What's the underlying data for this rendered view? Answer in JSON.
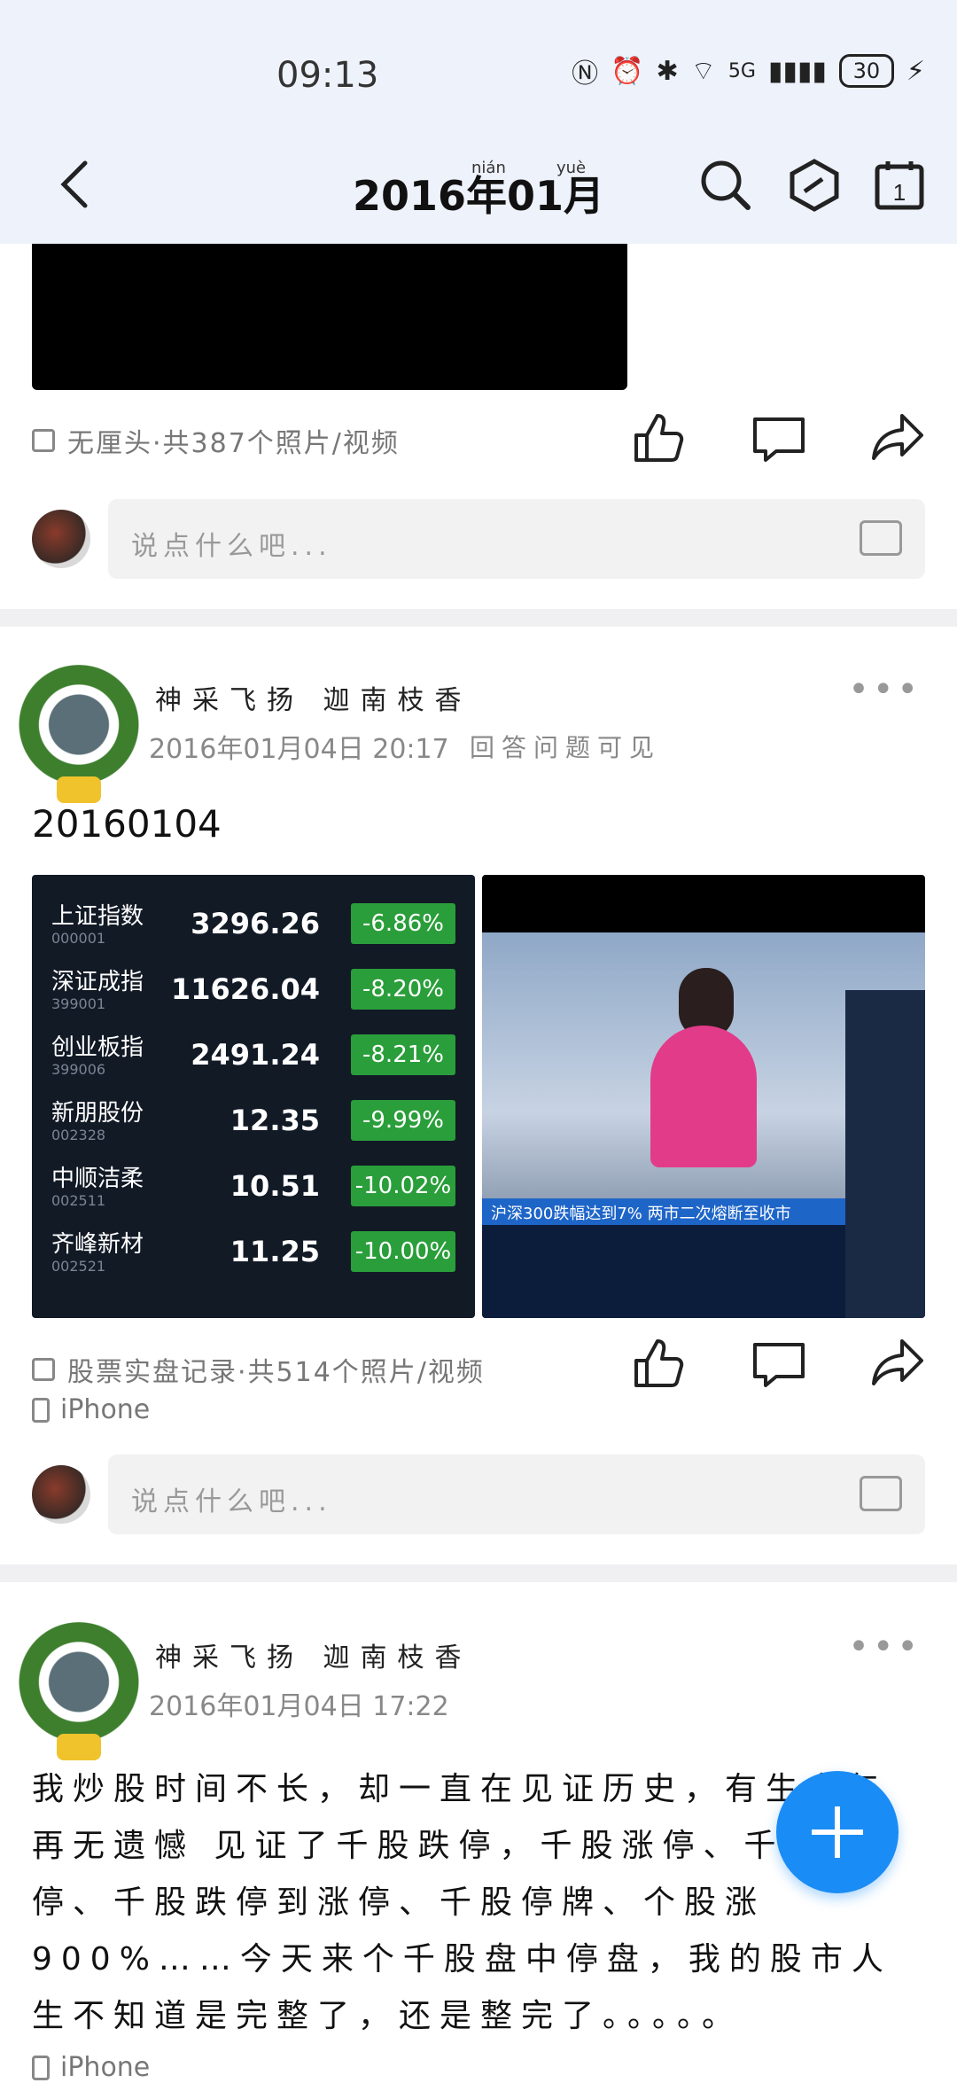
{
  "status_bar": {
    "time": "09:13",
    "battery": "30",
    "network": "5G"
  },
  "header": {
    "title": "2016年01月",
    "title_ruby_1": "nián",
    "title_ruby_2": "yuè",
    "calendar_day": "1"
  },
  "post_prev": {
    "album_meta": "无厘头·共387个照片/视频",
    "comment_placeholder": "说点什么吧..."
  },
  "post_1": {
    "author": "神采飞扬 迦南枝香",
    "date": "2016年01月04日 20:17",
    "hint": "回答问题可见",
    "title": "20160104",
    "stocks": [
      {
        "name": "上证指数",
        "code": "000001",
        "price": "3296.26",
        "change": "-6.86%"
      },
      {
        "name": "深证成指",
        "code": "399001",
        "price": "11626.04",
        "change": "-8.20%"
      },
      {
        "name": "创业板指",
        "code": "399006",
        "price": "2491.24",
        "change": "-8.21%"
      },
      {
        "name": "新朋股份",
        "code": "002328",
        "price": "12.35",
        "change": "-9.99%"
      },
      {
        "name": "中顺洁柔",
        "code": "002511",
        "price": "10.51",
        "change": "-10.02%"
      },
      {
        "name": "齐峰新材",
        "code": "002521",
        "price": "11.25",
        "change": "-10.00%"
      }
    ],
    "news_ticker": "沪深300跌幅达到7% 两市二次熔断至收市",
    "album_meta": "股票实盘记录·共514个照片/视频",
    "device": "iPhone",
    "comment_placeholder": "说点什么吧..."
  },
  "post_2": {
    "author": "神采飞扬 迦南枝香",
    "date": "2016年01月04日 17:22",
    "text": "我炒股时间不长，却一直在见证历史，有生之年再无遗憾 见证了千股跌停，千股涨停、千股跌停、千股跌停到涨停、千股停牌、个股涨900%……今天来个千股盘中停盘，我的股市人生不知道是完整了，还是整完了。。。。。",
    "device": "iPhone"
  }
}
